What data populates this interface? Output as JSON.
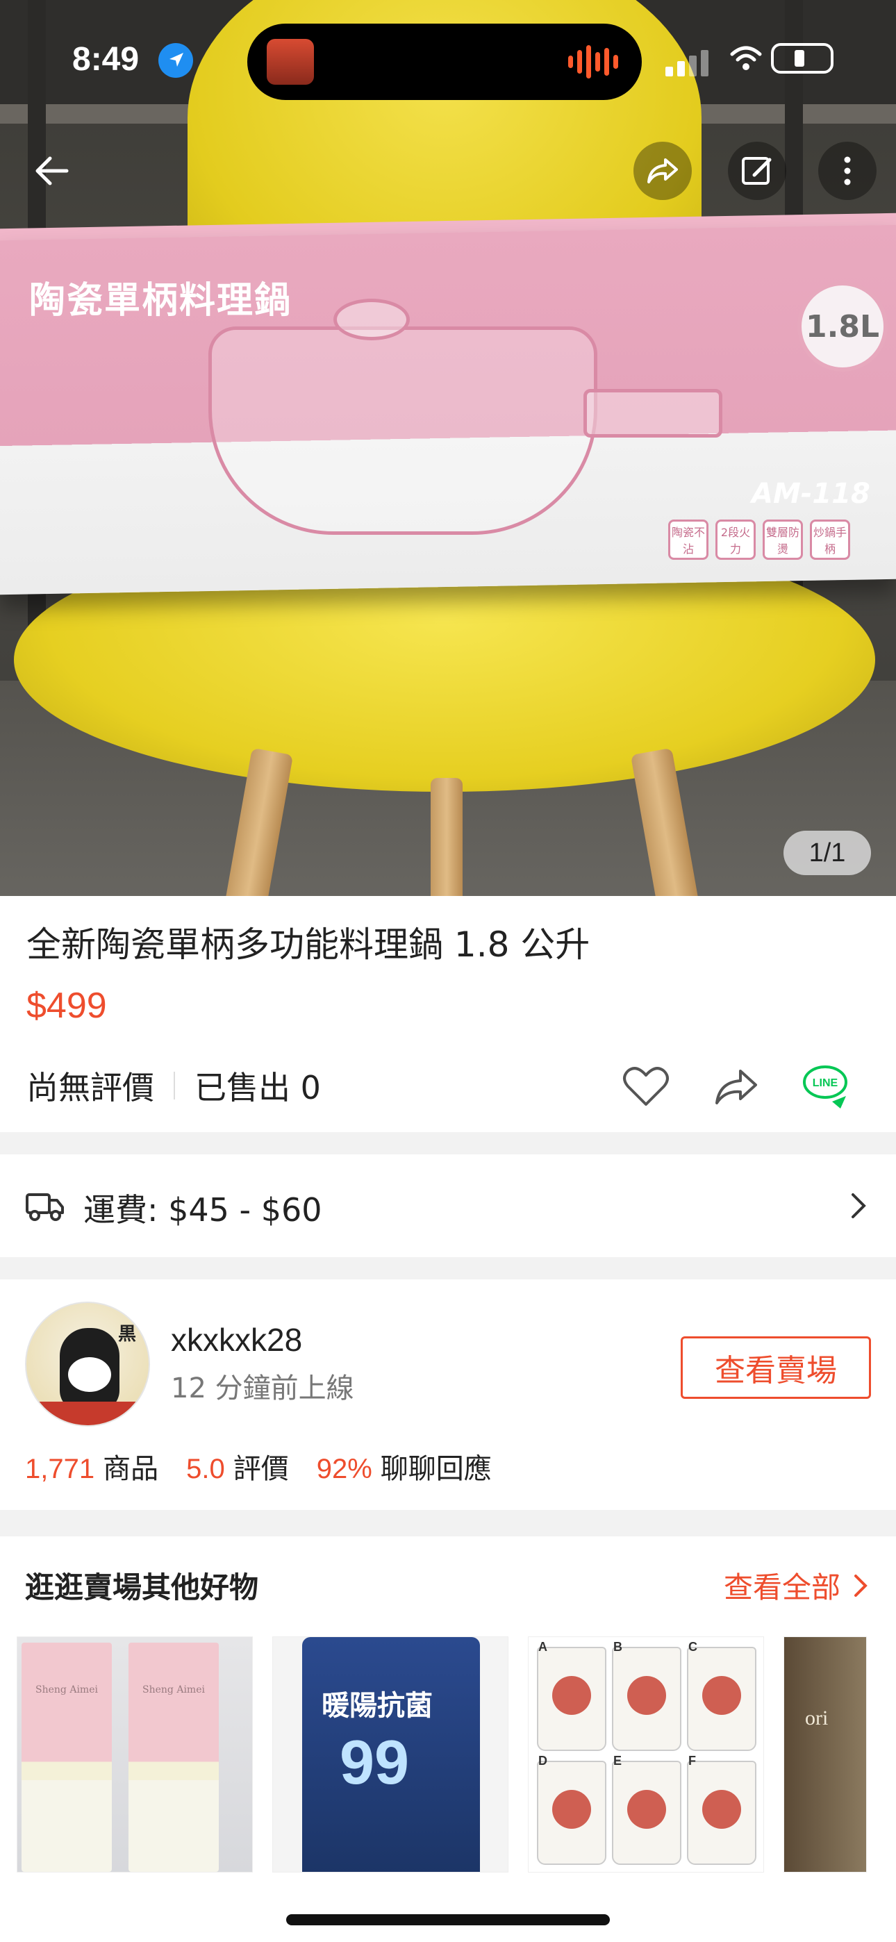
{
  "status_bar": {
    "time": "8:49"
  },
  "gallery": {
    "counter": "1/1",
    "box_title": "陶瓷單柄料理鍋",
    "box_volume": "1.8L",
    "box_model": "AM-118",
    "box_features": [
      "陶瓷不沾",
      "2段火力",
      "雙層防燙",
      "炒鍋手柄"
    ]
  },
  "product": {
    "title": "全新陶瓷單柄多功能料理鍋 1.8 公升",
    "price": "$499",
    "rating_text": "尚無評價",
    "sold_text": "已售出 0"
  },
  "shipping": {
    "text": "運費: $45 - $60"
  },
  "seller": {
    "name": "xkxkxk28",
    "online": "12 分鐘前上線",
    "view_shop_label": "查看賣場",
    "avatar_char": "黒",
    "stats": [
      {
        "value": "1,771",
        "label": "商品"
      },
      {
        "value": "5.0",
        "label": "評價"
      },
      {
        "value": "92%",
        "label": "聊聊回應"
      }
    ]
  },
  "more_items": {
    "title": "逛逛賣場其他好物",
    "view_all_label": "查看全部",
    "thumb_texts": {
      "brand": "Sheng Aimei",
      "bag_label": "暖陽抗菌",
      "bag_num": "99",
      "cup_letters": [
        "A",
        "B",
        "C",
        "D",
        "E",
        "F"
      ],
      "partial_label": "ori"
    }
  },
  "colors": {
    "accent": "#ee4d2d",
    "line_green": "#06c755"
  }
}
